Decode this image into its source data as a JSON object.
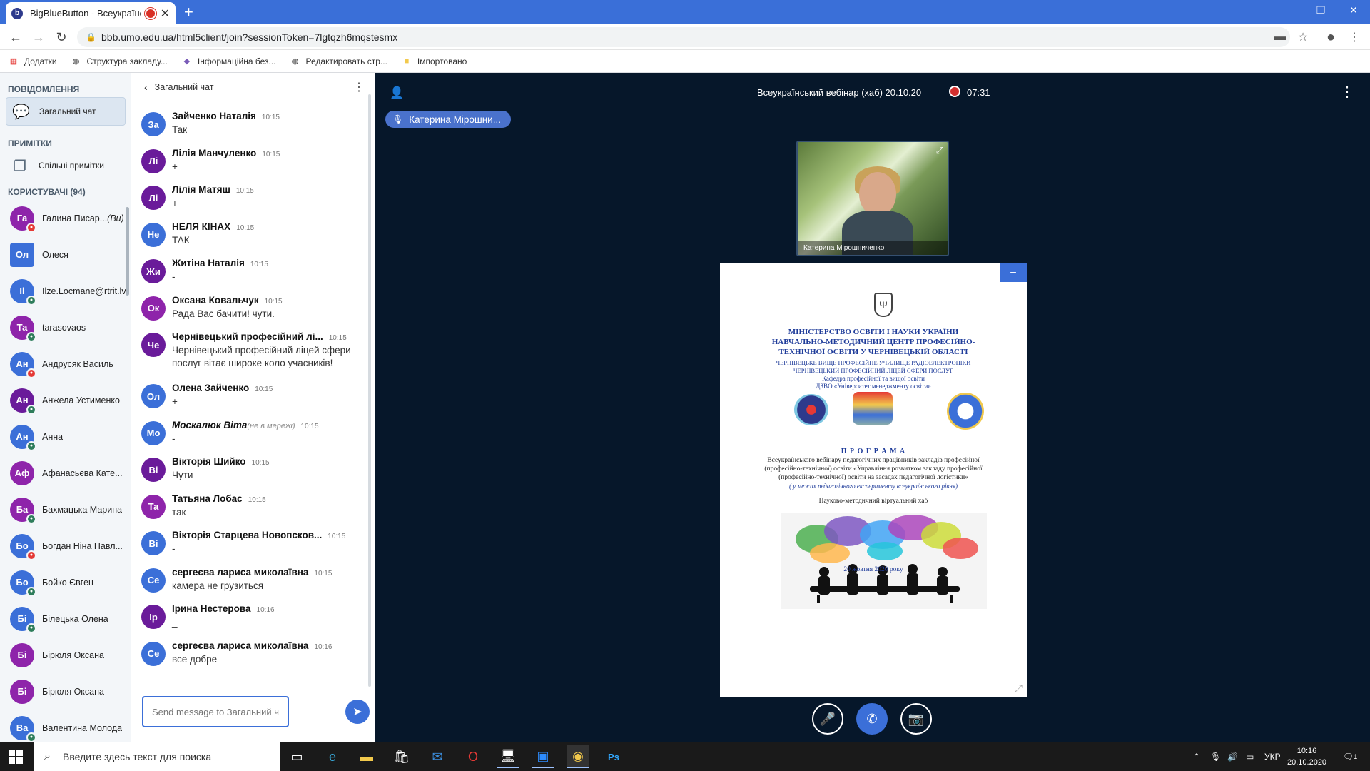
{
  "browser": {
    "tab_title": "BigBlueButton - Всеукраїнсь",
    "tab_favicon": "b",
    "url": "bbb.umo.edu.ua/html5client/join?sessionToken=7lgtqzh6mqstesmx",
    "bookmarks": [
      "Додатки",
      "Структура закладу...",
      "Інформаційна без...",
      "Редактировать стр...",
      "Імпортовано"
    ]
  },
  "sidebar": {
    "messages_header": "ПОВІДОМЛЕННЯ",
    "public_chat": "Загальний чат",
    "notes_header": "ПРИМІТКИ",
    "shared_notes": "Спільні примітки",
    "users_header": "КОРИСТУВАЧІ (94)",
    "users": [
      {
        "initials": "Га",
        "name": "Галина Писар...",
        "suffix": "(Ви)",
        "color": "#8e24aa",
        "badge": "#e53935"
      },
      {
        "initials": "Ол",
        "name": "Олеся",
        "suffix": "",
        "color": "#3b6fd8",
        "badge": "",
        "square": true
      },
      {
        "initials": "Il",
        "name": "Ilze.Locmane@rtrit.lv",
        "suffix": "",
        "color": "#3b6fd8",
        "badge": "#2e7d5b"
      },
      {
        "initials": "Та",
        "name": "tarasovaos",
        "suffix": "",
        "color": "#8e24aa",
        "badge": "#2e7d5b"
      },
      {
        "initials": "Ан",
        "name": "Андрусяк Василь",
        "suffix": "",
        "color": "#3b6fd8",
        "badge": "#e53935"
      },
      {
        "initials": "Ан",
        "name": "Анжела Устименко",
        "suffix": "",
        "color": "#6a1b9a",
        "badge": "#2e7d5b"
      },
      {
        "initials": "Ан",
        "name": "Анна",
        "suffix": "",
        "color": "#3b6fd8",
        "badge": "#2e7d5b"
      },
      {
        "initials": "Аф",
        "name": "Афанасьєва Кате...",
        "suffix": "",
        "color": "#8e24aa",
        "badge": ""
      },
      {
        "initials": "Ба",
        "name": "Бахмацька Марина",
        "suffix": "",
        "color": "#8e24aa",
        "badge": "#2e7d5b"
      },
      {
        "initials": "Бо",
        "name": "Богдан Ніна Павл...",
        "suffix": "",
        "color": "#3b6fd8",
        "badge": "#e53935"
      },
      {
        "initials": "Бо",
        "name": "Бойко Євген",
        "suffix": "",
        "color": "#3b6fd8",
        "badge": "#2e7d5b"
      },
      {
        "initials": "Бі",
        "name": "Білецька Олена",
        "suffix": "",
        "color": "#3b6fd8",
        "badge": "#2e7d5b"
      },
      {
        "initials": "Бі",
        "name": "Бірюля Оксана",
        "suffix": "",
        "color": "#8e24aa",
        "badge": ""
      },
      {
        "initials": "Бі",
        "name": "Бірюля Оксана",
        "suffix": "",
        "color": "#8e24aa",
        "badge": ""
      },
      {
        "initials": "Ва",
        "name": "Валентина Молода",
        "suffix": "",
        "color": "#3b6fd8",
        "badge": "#2e7d5b"
      }
    ]
  },
  "chat": {
    "title": "Загальний чат",
    "messages": [
      {
        "initials": "За",
        "name": "Зайченко Наталія",
        "time": "10:15",
        "text": "Так",
        "color": "#3b6fd8"
      },
      {
        "initials": "Лі",
        "name": "Лілія Манчуленко",
        "time": "10:15",
        "text": "+",
        "color": "#6a1b9a"
      },
      {
        "initials": "Лі",
        "name": "Лілія Матяш",
        "time": "10:15",
        "text": "+",
        "color": "#6a1b9a"
      },
      {
        "initials": "Не",
        "name": "НЕЛЯ КІНАХ",
        "time": "10:15",
        "text": "ТАК",
        "color": "#3b6fd8"
      },
      {
        "initials": "Жи",
        "name": "Житіна Наталія",
        "time": "10:15",
        "text": "-",
        "color": "#6a1b9a"
      },
      {
        "initials": "Ок",
        "name": "Оксана Ковальчук",
        "time": "10:15",
        "text": "Рада Вас бачити! чути.",
        "color": "#8e24aa"
      },
      {
        "initials": "Че",
        "name": "Чернівецький професійний лі...",
        "time": "10:15",
        "text": "Чернівецький професійний ліцей сфери послуг вітає широке коло учасників!",
        "color": "#6a1b9a",
        "tall": true
      },
      {
        "initials": "Ол",
        "name": "Олена Зайченко",
        "time": "10:15",
        "text": "+",
        "color": "#3b6fd8"
      },
      {
        "initials": "Мо",
        "name": "Москалюк Віта",
        "offline": "(не в мережі)",
        "time": "10:15",
        "text": "-",
        "color": "#3b6fd8"
      },
      {
        "initials": "Ві",
        "name": "Вікторія Шийко",
        "time": "10:15",
        "text": "Чути",
        "color": "#6a1b9a"
      },
      {
        "initials": "Та",
        "name": "Татьяна Лобас",
        "time": "10:15",
        "text": "так",
        "color": "#8e24aa"
      },
      {
        "initials": "Ві",
        "name": "Вікторія Старцева Новопсков...",
        "time": "10:15",
        "text": "-",
        "color": "#3b6fd8"
      },
      {
        "initials": "Се",
        "name": "сергеєва лариса миколаївна",
        "time": "10:15",
        "text": "камера не грузиться",
        "color": "#3b6fd8"
      },
      {
        "initials": "Ір",
        "name": "Ірина Нестерова",
        "time": "10:16",
        "text": "_",
        "color": "#6a1b9a"
      },
      {
        "initials": "Се",
        "name": "сергеєва лариса миколаївна",
        "time": "10:16",
        "text": "все добре",
        "color": "#3b6fd8"
      }
    ],
    "input_placeholder": "Send message to Загальний чат"
  },
  "stage": {
    "title": "Всеукраїнський вебінар (хаб) 20.10.20",
    "rec_time": "07:31",
    "talker": "Катерина Мірошни...",
    "webcam_name": "Катерина Мірошниченко"
  },
  "slide": {
    "l1": "МІНІСТЕРСТВО ОСВІТИ І НАУКИ УКРАЇНИ",
    "l2": "НАВЧАЛЬНО-МЕТОДИЧНИЙ ЦЕНТР ПРОФЕСІЙНО-",
    "l3": "ТЕХНІЧНОЇ ОСВІТИ У ЧЕРНІВЕЦЬКІЙ ОБЛАСТІ",
    "l4": "ЧЕРНІВЕЦЬКЕ ВИЩЕ ПРОФЕСІЙНЕ УЧИЛИЩЕ РАДІОЕЛЕКТРОНІКИ",
    "l5": "ЧЕРНІВЕЦЬКИЙ ПРОФЕСІЙНИЙ ЛІЦЕЙ СФЕРИ ПОСЛУГ",
    "l6": "Кафедра професійної та вищої освіти",
    "l7": "ДЗВО «Університет менеджменту освіти»",
    "program": "П Р О Г Р А М А",
    "p1": "Всеукраїнського вебінару  педагогічних працівників закладів професійної",
    "p2": "(професійно-технічної) освіти «Управління розвитком закладу професійної",
    "p3": "(професійно-технічної) освіти на засадах педагогічної логістики»",
    "p4": "( у межах педагогічного експерименту всеукраїнського рівня)",
    "hub": "Науково-методичний віртуальний хаб",
    "date": "20 жовтня 2020 року"
  },
  "taskbar": {
    "search_placeholder": "Введите здесь текст для поиска",
    "lang": "УКР",
    "time": "10:16",
    "date": "20.10.2020",
    "notif_count": "1"
  }
}
